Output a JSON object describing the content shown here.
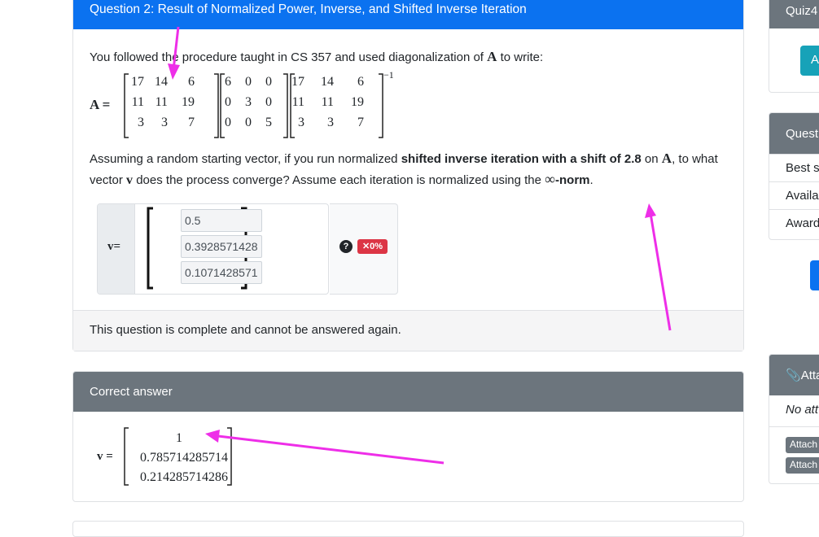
{
  "question": {
    "header": "Question 2: Result of Normalized Power, Inverse, and Shifted Inverse Iteration",
    "intro_before": "You followed the procedure taught in CS 357 and used diagonalization of",
    "intro_symbol": "A",
    "intro_after": "to write:",
    "matrix_lhs": "A =",
    "matrix_P": [
      [
        "17",
        "14",
        "6"
      ],
      [
        "11",
        "11",
        "19"
      ],
      [
        "3",
        "3",
        "7"
      ]
    ],
    "matrix_D": [
      [
        "6",
        "0",
        "0"
      ],
      [
        "0",
        "3",
        "0"
      ],
      [
        "0",
        "0",
        "5"
      ]
    ],
    "matrix_Pinv": [
      [
        "17",
        "14",
        "6"
      ],
      [
        "11",
        "11",
        "19"
      ],
      [
        "3",
        "3",
        "7"
      ]
    ],
    "inverse_exponent": "−1",
    "text_1": "Assuming a random starting vector, if you run normalized",
    "text_bold": "shifted inverse iteration with a shift of 2.8",
    "text_2": "on",
    "text_symbol": "A",
    "text_3": "to what vector",
    "text_v": "v",
    "text_4": "does the process converge? Assume each iteration is normalized using the",
    "text_inf": "∞",
    "text_norm": "-norm",
    "text_end": ".",
    "v_label": "v=",
    "inputs": [
      "0.5",
      "0.3928571428",
      "0.1071428571"
    ],
    "help_icon": "?",
    "score_badge": "✕0%",
    "complete_msg": "This question is complete and cannot be answered again."
  },
  "answer": {
    "header": "Correct answer",
    "v_label": "v =",
    "values": [
      "1",
      "0.785714285714",
      "0.214285714286"
    ]
  },
  "sidebar": {
    "quiz_head": "Quiz4",
    "quiz_btn": "A",
    "question_head": "Quest",
    "rows": [
      "Best s",
      "Availa",
      "Award"
    ],
    "attach_head": "Atta",
    "attach_empty": "No att",
    "attach_buttons": [
      "Attach",
      "Attach"
    ]
  },
  "colors": {
    "primary": "#0b72f0",
    "secondary": "#6c757d",
    "danger": "#dc3545",
    "annotation": "#ee2ee8",
    "teal": "#17a2b8"
  }
}
